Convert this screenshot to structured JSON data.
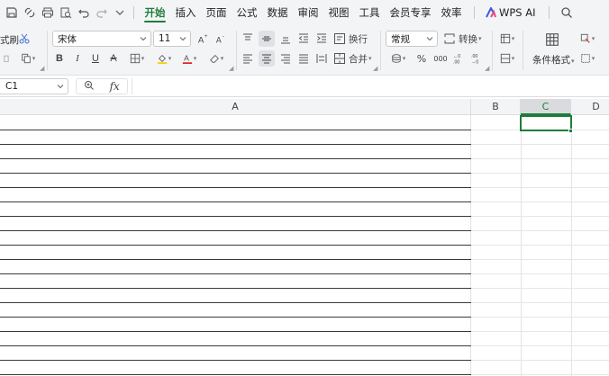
{
  "menubar": {
    "tabs": [
      "开始",
      "插入",
      "页面",
      "公式",
      "数据",
      "审阅",
      "视图",
      "工具",
      "会员专享",
      "效率"
    ],
    "active_tab": "开始",
    "ai_label": "WPS AI"
  },
  "ribbon": {
    "format_painter_label": "式刷",
    "font_name": "宋体",
    "font_size": "11",
    "wrap_label": "换行",
    "merge_label": "合并",
    "number_format": "常规",
    "convert_label": "转换",
    "percent_symbol": "%",
    "thousands_symbol": "000",
    "cond_format_label": "条件格式",
    "font_color": "#e02020",
    "fill_color": "#f5d000"
  },
  "formulabar": {
    "cell_ref": "C1",
    "fx_label": "fx"
  },
  "grid": {
    "columns": [
      "A",
      "B",
      "C",
      "D"
    ],
    "selected_column": "C",
    "selected_cell": "C1"
  },
  "colors": {
    "accent": "#1e7d3b",
    "toolbar_bg": "#f3f4f6"
  }
}
